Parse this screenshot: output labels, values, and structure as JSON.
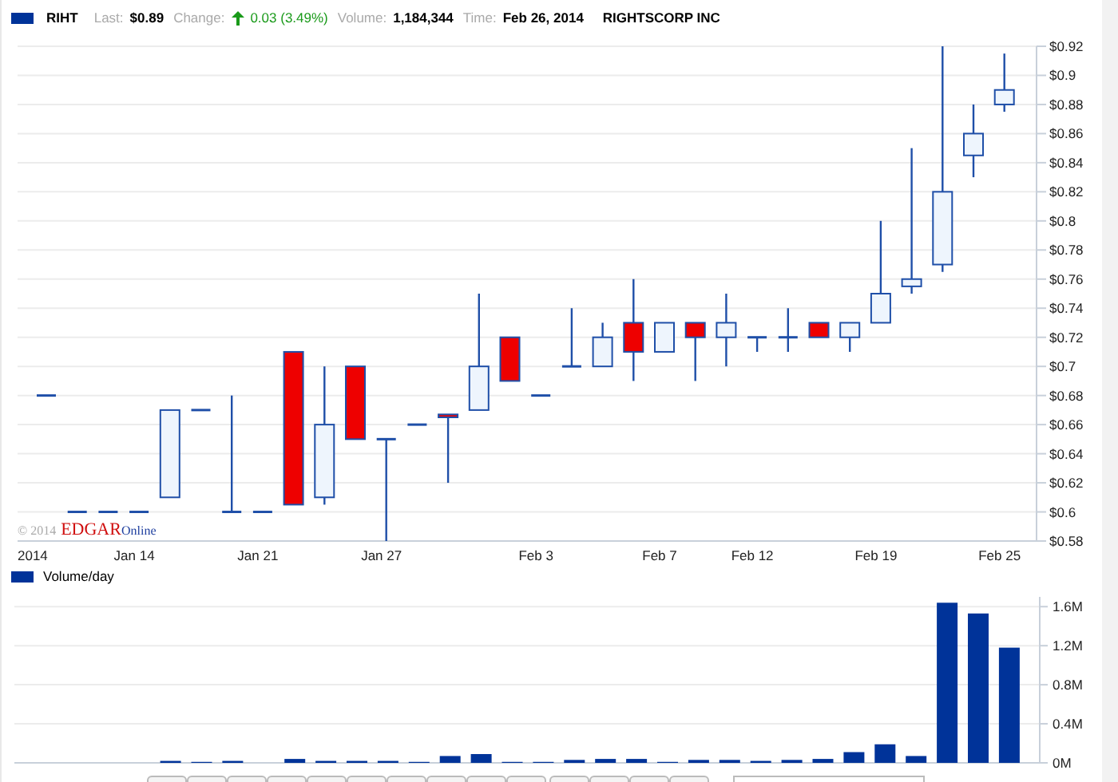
{
  "header": {
    "symbol": "RIHT",
    "last_label": "Last:",
    "last": "$0.89",
    "change_label": "Change:",
    "change": "0.03 (3.49%)",
    "volume_label": "Volume:",
    "volume": "1,184,344",
    "time_label": "Time:",
    "time": "Feb 26, 2014",
    "company": "RIGHTSCORP INC"
  },
  "credit": {
    "year": "© 2014",
    "brand": "EDGAR",
    "brand_suffix": "Online"
  },
  "price_chart": {
    "chart_data": {
      "type": "candlestick",
      "categories": [
        "2014",
        null,
        null,
        "Jan 14",
        null,
        null,
        null,
        "Jan 21",
        null,
        null,
        null,
        "Jan 27",
        null,
        null,
        null,
        null,
        "Feb 3",
        null,
        null,
        null,
        "Feb 7",
        null,
        null,
        "Feb 12",
        null,
        null,
        null,
        "Feb 19",
        null,
        null,
        null,
        "Feb 25"
      ],
      "ohlc": [
        [
          0.68,
          0.68,
          0.68,
          0.68
        ],
        [
          0.6,
          0.6,
          0.6,
          0.6
        ],
        [
          0.6,
          0.6,
          0.6,
          0.6
        ],
        [
          0.6,
          0.6,
          0.6,
          0.6
        ],
        [
          0.61,
          0.67,
          0.61,
          0.67
        ],
        [
          0.67,
          0.67,
          0.67,
          0.67
        ],
        [
          0.6,
          0.68,
          0.6,
          0.6
        ],
        [
          0.6,
          0.6,
          0.6,
          0.6
        ],
        [
          0.71,
          0.71,
          0.605,
          0.605
        ],
        [
          0.61,
          0.7,
          0.605,
          0.66
        ],
        [
          0.7,
          0.7,
          0.65,
          0.65
        ],
        [
          0.65,
          0.65,
          0.58,
          0.65
        ],
        [
          0.66,
          0.66,
          0.66,
          0.66
        ],
        [
          0.667,
          0.667,
          0.62,
          0.665
        ],
        [
          0.67,
          0.75,
          0.67,
          0.7
        ],
        [
          0.72,
          0.72,
          0.69,
          0.69
        ],
        [
          0.68,
          0.68,
          0.68,
          0.68
        ],
        [
          0.7,
          0.74,
          0.7,
          0.7
        ],
        [
          0.7,
          0.73,
          0.7,
          0.72
        ],
        [
          0.73,
          0.76,
          0.69,
          0.71
        ],
        [
          0.71,
          0.73,
          0.71,
          0.73
        ],
        [
          0.73,
          0.73,
          0.69,
          0.72
        ],
        [
          0.72,
          0.75,
          0.7,
          0.73
        ],
        [
          0.72,
          0.72,
          0.71,
          0.72
        ],
        [
          0.72,
          0.74,
          0.71,
          0.72
        ],
        [
          0.73,
          0.73,
          0.72,
          0.72
        ],
        [
          0.72,
          0.73,
          0.71,
          0.73
        ],
        [
          0.73,
          0.8,
          0.73,
          0.75
        ],
        [
          0.755,
          0.85,
          0.75,
          0.76
        ],
        [
          0.77,
          0.92,
          0.765,
          0.82
        ],
        [
          0.845,
          0.88,
          0.83,
          0.86
        ],
        [
          0.88,
          0.915,
          0.875,
          0.89
        ]
      ],
      "ylim": [
        0.58,
        0.92
      ],
      "grid": true,
      "yticks": [
        {
          "value": 0.58,
          "label": "$0.58"
        },
        {
          "value": 0.6,
          "label": "$0.6"
        },
        {
          "value": 0.62,
          "label": "$0.62"
        },
        {
          "value": 0.64,
          "label": "$0.64"
        },
        {
          "value": 0.66,
          "label": "$0.66"
        },
        {
          "value": 0.68,
          "label": "$0.68"
        },
        {
          "value": 0.7,
          "label": "$0.7"
        },
        {
          "value": 0.72,
          "label": "$0.72"
        },
        {
          "value": 0.74,
          "label": "$0.74"
        },
        {
          "value": 0.76,
          "label": "$0.76"
        },
        {
          "value": 0.78,
          "label": "$0.78"
        },
        {
          "value": 0.8,
          "label": "$0.8"
        },
        {
          "value": 0.82,
          "label": "$0.82"
        },
        {
          "value": 0.84,
          "label": "$0.84"
        },
        {
          "value": 0.86,
          "label": "$0.86"
        },
        {
          "value": 0.88,
          "label": "$0.88"
        },
        {
          "value": 0.9,
          "label": "$0.9"
        },
        {
          "value": 0.92,
          "label": "$0.92"
        }
      ]
    }
  },
  "volume_chart": {
    "chart_data": {
      "type": "bar",
      "series": [
        {
          "name": "Volume/day",
          "color": "#003399",
          "values": [
            null,
            null,
            null,
            null,
            0.02,
            0.01,
            0.02,
            0,
            0.04,
            0.02,
            0.02,
            0.02,
            0.01,
            0.07,
            0.09,
            0.01,
            0.01,
            0.03,
            0.04,
            0.04,
            0.01,
            0.03,
            0.03,
            0.02,
            0.03,
            0.04,
            0.11,
            0.19,
            0.07,
            1.64,
            1.53,
            1.18
          ]
        }
      ],
      "ylim": [
        0,
        1.7
      ],
      "grid": true,
      "yticks": [
        {
          "value": 0,
          "label": "0M"
        },
        {
          "value": 0.4,
          "label": "0.4M"
        },
        {
          "value": 0.8,
          "label": "0.8M"
        },
        {
          "value": 1.2,
          "label": "1.2M"
        },
        {
          "value": 1.6,
          "label": "1.6M"
        }
      ]
    }
  }
}
